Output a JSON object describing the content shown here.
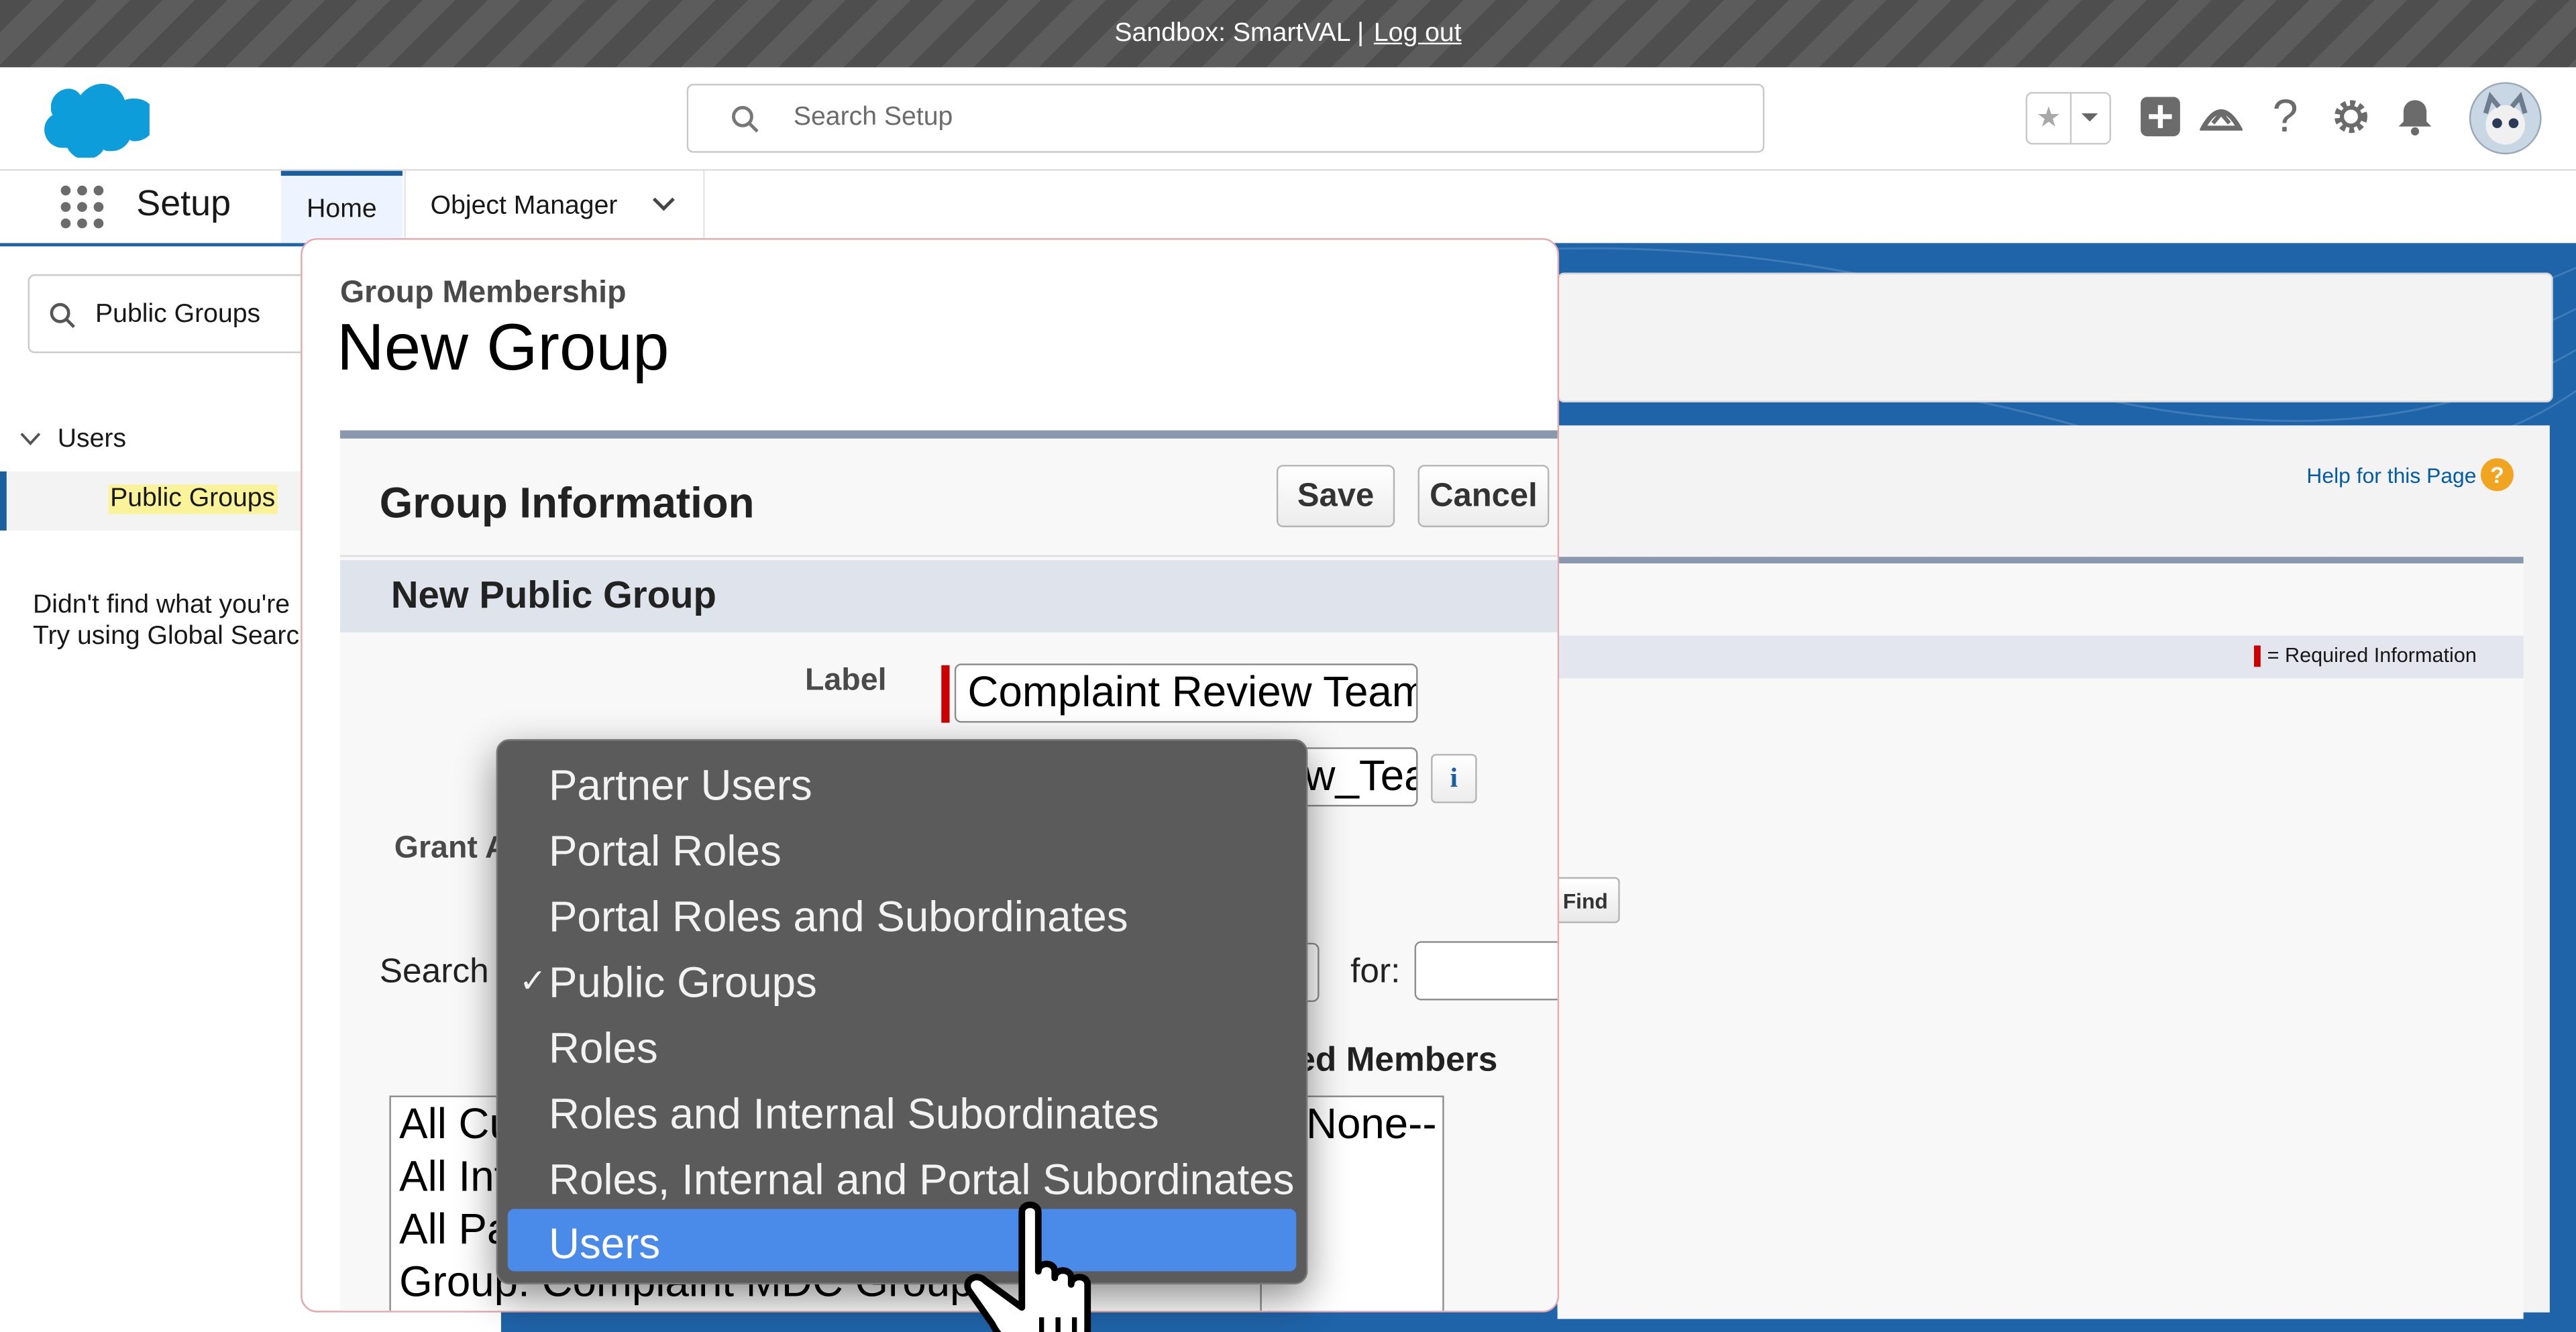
{
  "sandbox_bar": {
    "text": "Sandbox: SmartVAL |",
    "logout": "Log out"
  },
  "header": {
    "search_placeholder": "Search Setup"
  },
  "icons": [
    "salesforce-cloud-logo",
    "search-icon",
    "star-icon",
    "chevron-down-icon",
    "plus-icon",
    "trailhead-icon",
    "help-icon",
    "gear-icon",
    "bell-icon",
    "avatar",
    "app-launcher-icon",
    "cursor-hand-icon"
  ],
  "context_bar": {
    "app_name": "Setup",
    "tabs": [
      {
        "label": "Home"
      },
      {
        "label": "Object Manager"
      }
    ]
  },
  "sidebar": {
    "quick_find_value": "Public Groups",
    "tree_parent": "Users",
    "tree_child": "Public Groups",
    "not_found_line1": "Didn't find what you're",
    "not_found_line2": "Try using Global Search"
  },
  "background_page": {
    "help_link": "Help for this Page",
    "required_info": "= Required Information",
    "find_button": "Find"
  },
  "modal": {
    "subtitle": "Group Membership",
    "title": "New Group",
    "section_title": "Group Information",
    "save": "Save",
    "cancel": "Cancel",
    "sub_section": "New Public Group",
    "label_field": "Label",
    "label_value": "Complaint Review Team",
    "group_name_value": "w_Tea",
    "grant_label": "Grant A",
    "search_label": "Search",
    "for_label": "for:",
    "selected_members_header": "ed Members",
    "available_members": [
      "All Cu",
      "All Int",
      "All Pa",
      "Group: Complaint MDC Group"
    ],
    "selected_members": [
      "None--"
    ]
  },
  "dropdown": {
    "items": [
      {
        "label": "Partner Users",
        "checked": false,
        "highlighted": false
      },
      {
        "label": "Portal Roles",
        "checked": false,
        "highlighted": false
      },
      {
        "label": "Portal Roles and Subordinates",
        "checked": false,
        "highlighted": false
      },
      {
        "label": "Public Groups",
        "checked": true,
        "highlighted": false
      },
      {
        "label": "Roles",
        "checked": false,
        "highlighted": false
      },
      {
        "label": "Roles and Internal Subordinates",
        "checked": false,
        "highlighted": false
      },
      {
        "label": "Roles, Internal and Portal Subordinates",
        "checked": false,
        "highlighted": false
      },
      {
        "label": "Users",
        "checked": false,
        "highlighted": true
      }
    ]
  },
  "colors": {
    "brand_blue": "#1b5f9e",
    "highlight": "#4a8ae9",
    "required_red": "#cc0000",
    "search_highlight": "#fbf39a"
  }
}
